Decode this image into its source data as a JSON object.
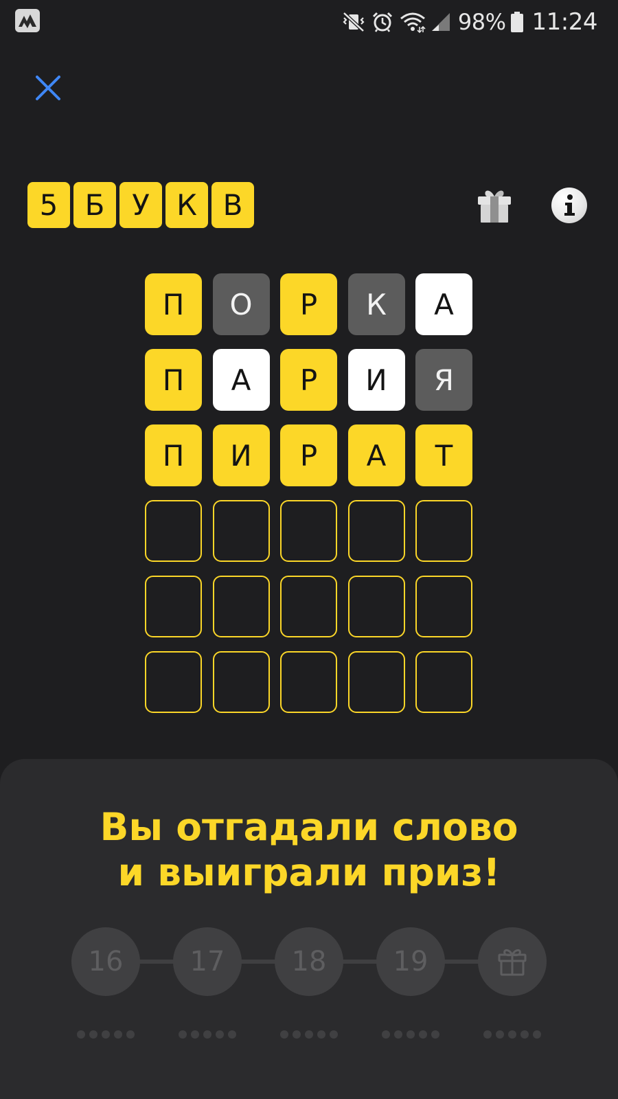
{
  "status_bar": {
    "battery": "98%",
    "time": "11:24",
    "icons": [
      "app-notification-icon",
      "mute-vibrate-icon",
      "alarm-icon",
      "wifi-icon",
      "cell-signal-icon",
      "battery-icon"
    ]
  },
  "header": {
    "close_icon": "close-icon",
    "logo_letters": [
      "5",
      "Б",
      "У",
      "К",
      "В"
    ],
    "gift_icon": "gift-icon",
    "info_icon": "info-icon"
  },
  "board": {
    "rows": [
      [
        {
          "letter": "П",
          "state": "correct"
        },
        {
          "letter": "О",
          "state": "absent"
        },
        {
          "letter": "Р",
          "state": "correct"
        },
        {
          "letter": "К",
          "state": "absent"
        },
        {
          "letter": "А",
          "state": "present"
        }
      ],
      [
        {
          "letter": "П",
          "state": "correct"
        },
        {
          "letter": "А",
          "state": "present"
        },
        {
          "letter": "Р",
          "state": "correct"
        },
        {
          "letter": "И",
          "state": "present"
        },
        {
          "letter": "Я",
          "state": "absent"
        }
      ],
      [
        {
          "letter": "П",
          "state": "correct"
        },
        {
          "letter": "И",
          "state": "correct"
        },
        {
          "letter": "Р",
          "state": "correct"
        },
        {
          "letter": "А",
          "state": "correct"
        },
        {
          "letter": "Т",
          "state": "correct"
        }
      ],
      [
        {
          "letter": "",
          "state": "empty"
        },
        {
          "letter": "",
          "state": "empty"
        },
        {
          "letter": "",
          "state": "empty"
        },
        {
          "letter": "",
          "state": "empty"
        },
        {
          "letter": "",
          "state": "empty"
        }
      ],
      [
        {
          "letter": "",
          "state": "empty"
        },
        {
          "letter": "",
          "state": "empty"
        },
        {
          "letter": "",
          "state": "empty"
        },
        {
          "letter": "",
          "state": "empty"
        },
        {
          "letter": "",
          "state": "empty"
        }
      ],
      [
        {
          "letter": "",
          "state": "empty"
        },
        {
          "letter": "",
          "state": "empty"
        },
        {
          "letter": "",
          "state": "empty"
        },
        {
          "letter": "",
          "state": "empty"
        },
        {
          "letter": "",
          "state": "empty"
        }
      ]
    ]
  },
  "result": {
    "title_line1": "Вы отгадали слово",
    "title_line2": "и выиграли приз!"
  },
  "progress": {
    "steps": [
      {
        "label": "16",
        "dots": 5
      },
      {
        "label": "17",
        "dots": 5
      },
      {
        "label": "18",
        "dots": 5
      },
      {
        "label": "19",
        "dots": 5
      },
      {
        "label": "",
        "icon": "gift-icon",
        "dots": 5
      }
    ]
  },
  "colors": {
    "background": "#1e1e20",
    "accent_yellow": "#fcd728",
    "tile_absent": "#5c5c5c",
    "tile_present": "#ffffff",
    "sheet": "#2b2b2d",
    "close_blue": "#3f87f5"
  }
}
